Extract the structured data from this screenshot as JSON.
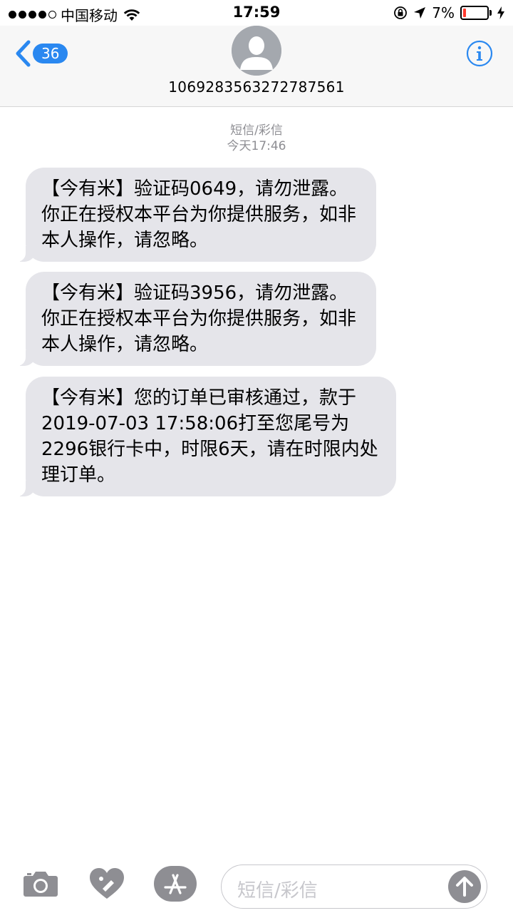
{
  "status_bar": {
    "carrier": "中国移动",
    "time": "17:59",
    "battery_percent": "7%"
  },
  "nav": {
    "back_count": "36",
    "contact_number": "1069283563272787561",
    "icons": [
      "chevron-left-icon",
      "avatar-icon",
      "info-icon"
    ]
  },
  "conversation": {
    "type_label": "短信/彩信",
    "timestamp": "今天17:46",
    "messages": [
      {
        "text": "【今有米】验证码0649，请勿泄露。你正在授权本平台为你提供服务，如非本人操作，请忽略。"
      },
      {
        "text": "【今有米】验证码3956，请勿泄露。你正在授权本平台为你提供服务，如非本人操作，请忽略。"
      },
      {
        "text": "【今有米】您的订单已审核通过，款于2019-07-03 17:58:06打至您尾号为2296银行卡中，时限6天，请在时限内处理订单。"
      }
    ]
  },
  "composer": {
    "placeholder": "短信/彩信",
    "icons": [
      "camera-icon",
      "digital-touch-icon",
      "app-store-icon",
      "send-arrow-icon"
    ]
  },
  "colors": {
    "accent": "#2a88f0",
    "bubble": "#e5e5ea",
    "meta_gray": "#8e8e93",
    "battery_low": "#ff3b30"
  }
}
